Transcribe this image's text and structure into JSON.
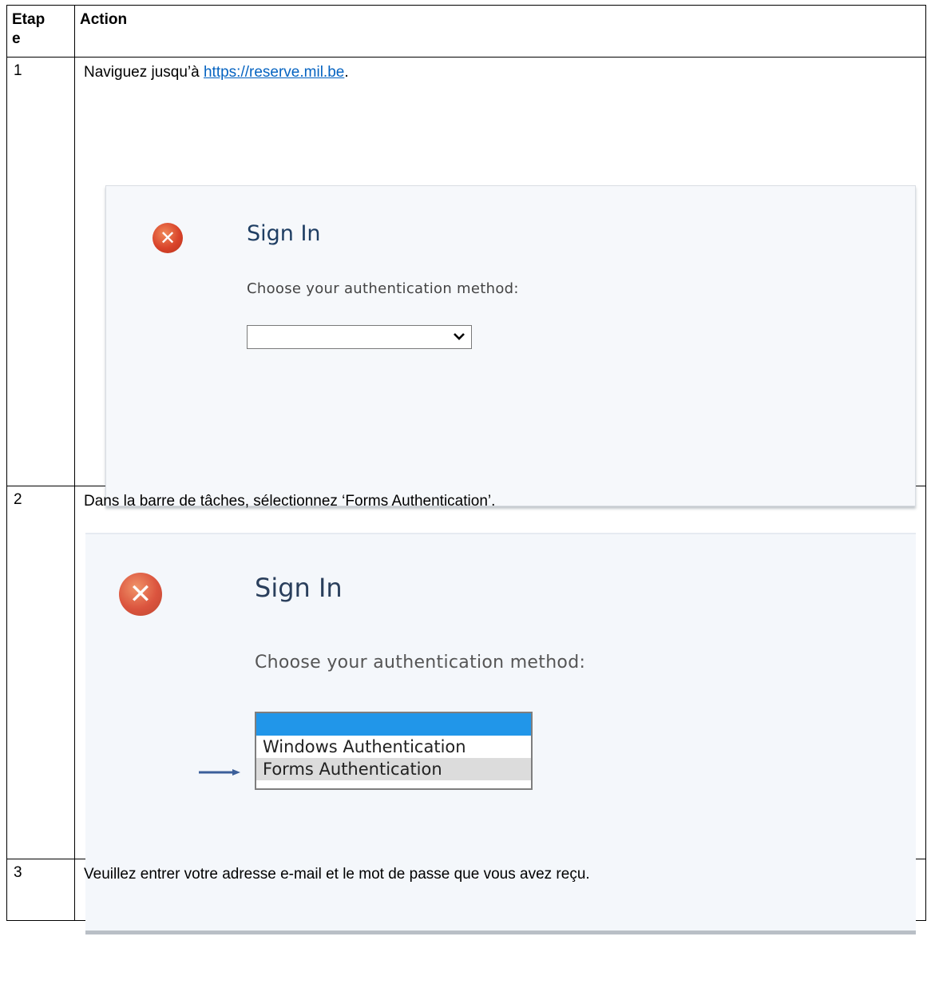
{
  "table": {
    "header": {
      "col1": "Etap\ne",
      "col1_line1": "Etap",
      "col1_line2": "e",
      "col2": "Action"
    },
    "rows": [
      {
        "step": "1",
        "text_before": "Naviguez jusqu’à  ",
        "link": "https://reserve.mil.be",
        "text_after": ".",
        "screenshot": {
          "title": "Sign In",
          "subtitle": "Choose your authentication method:",
          "select_value": "",
          "icon": "error-x-icon"
        }
      },
      {
        "step": "2",
        "text": "Dans la barre de tâches, sélectionnez  ‘Forms Authentication’.",
        "screenshot": {
          "title": "Sign In",
          "subtitle": "Choose your authentication method:",
          "options": [
            "Windows Authentication",
            "Forms Authentication"
          ],
          "highlighted_option": "Forms Authentication",
          "icon": "error-x-icon",
          "arrow_color": "#3b5f9a",
          "selection_color": "#2196e9"
        }
      },
      {
        "step": "3",
        "text": "Veuillez entrer votre adresse e-mail et le mot de passe que vous avez reçu."
      }
    ]
  },
  "colors": {
    "link": "#0563c1",
    "title": "#1f3e63",
    "error_icon": "#d9432a"
  }
}
